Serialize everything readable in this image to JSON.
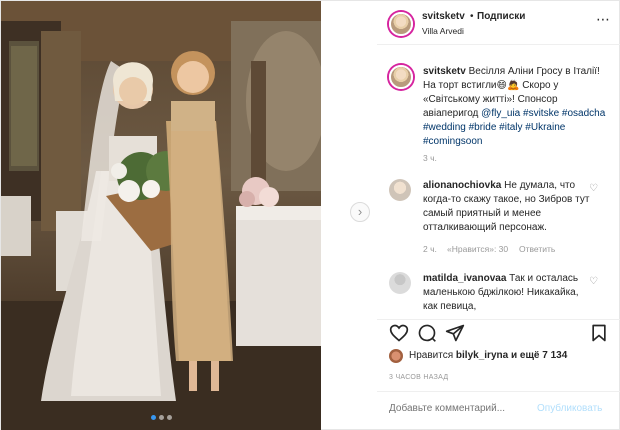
{
  "header": {
    "username": "svitsketv",
    "bullet": "•",
    "follow_label": "Подписки",
    "location": "Villa Arvedi",
    "more_icon": "⋯"
  },
  "caption": {
    "username": "svitsketv",
    "text1": "Весілля Аліни Гросу в Італії! На торт встигли",
    "text2": "Скоро у «Світському житті»! Спонсор авіаперигод",
    "mention": "@fly_uia",
    "hashtags1": "#svitske",
    "hashtags2": "#osadcha #wedding #bride #italy",
    "hashtags3": "#Ukraine #comingsoon",
    "time": "3 ч."
  },
  "comments": [
    {
      "username": "alionanochiovka",
      "text": "Не думала, что когда-то скажу такое, но Зибров тут самый приятный и менее отталкивающий персонаж.",
      "time": "2 ч.",
      "likes": "«Нравится»: 30",
      "reply": "Ответить"
    },
    {
      "username": "matilda_ivanovaa",
      "text": "Так и осталась маленькою бджілкою! Никакайка, как певица,"
    }
  ],
  "actions": {
    "like_icon": "heart-icon",
    "comment_icon": "comment-icon",
    "share_icon": "share-icon",
    "save_icon": "bookmark-icon"
  },
  "likes": {
    "prefix": "Нравится",
    "user": "bilyk_iryna",
    "suffix": "и ещё 7 134"
  },
  "time_ago": "3 ЧАСОВ НАЗАД",
  "add_comment": {
    "placeholder": "Добавьте комментарий...",
    "publish_label": "Опубликовать"
  },
  "colors": {
    "accent": "#3897f0",
    "story_ring": "#d6249f",
    "publish_disabled": "#b2dffc"
  }
}
